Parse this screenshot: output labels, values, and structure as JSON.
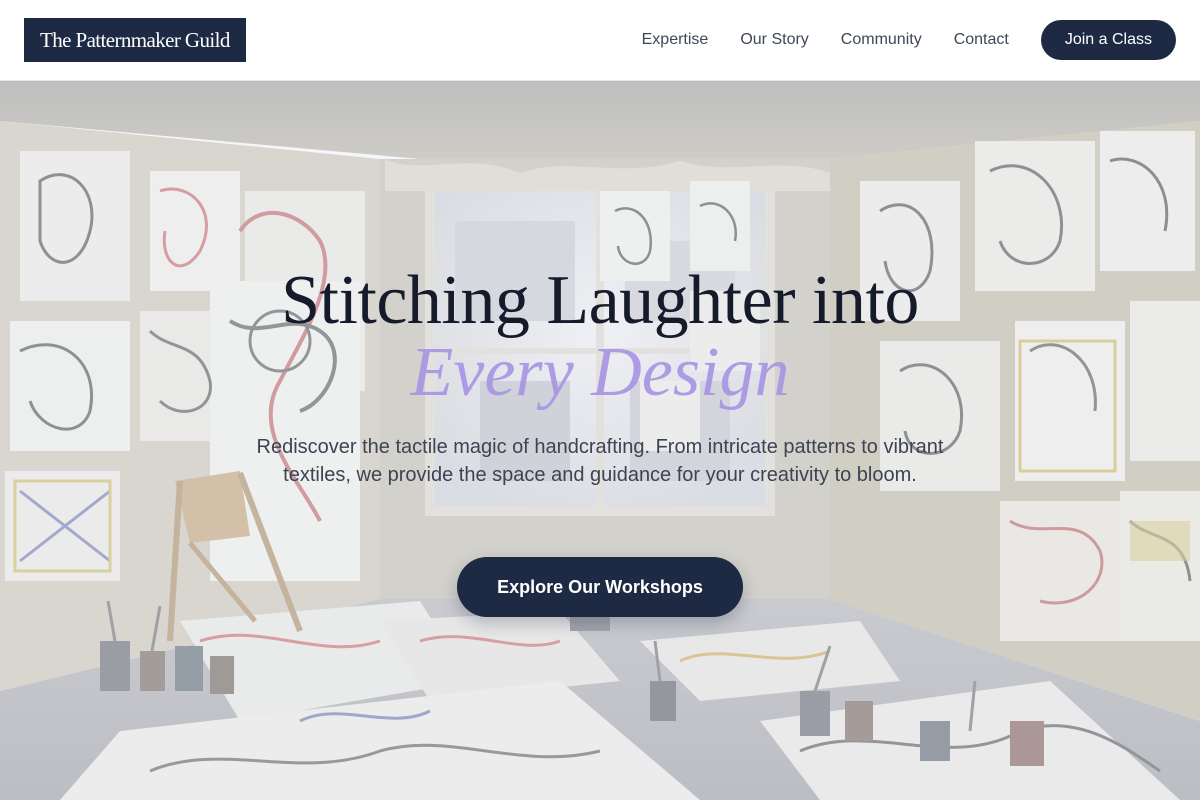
{
  "header": {
    "logo_text": "The Patternmaker Guild",
    "nav_links": [
      {
        "label": "Expertise"
      },
      {
        "label": "Our Story"
      },
      {
        "label": "Community"
      },
      {
        "label": "Contact"
      }
    ],
    "cta_label": "Join a Class"
  },
  "hero": {
    "title_line1": "Stitching Laughter into",
    "title_line2": "Every Design",
    "subtitle": "Rediscover the tactile magic of handcrafting. From intricate patterns to vibrant textiles, we provide the space and guidance for your creativity to bloom.",
    "button_label": "Explore Our Workshops",
    "background_image": "art-studio-room-photo"
  },
  "colors": {
    "brand_navy": "#1e2a44",
    "accent_lavender": "#a896e4",
    "nav_text": "#3f4756",
    "title_text": "#151b2b"
  }
}
